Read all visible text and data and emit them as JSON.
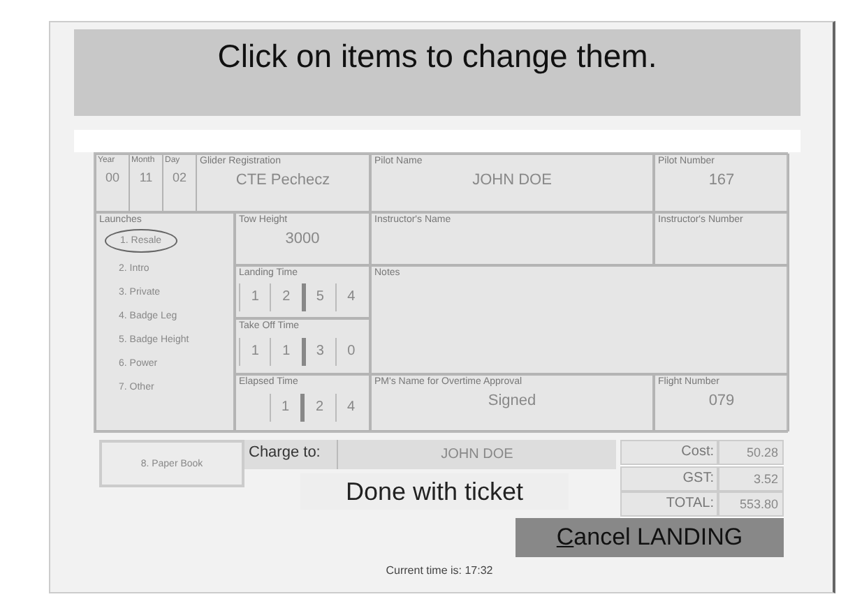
{
  "banner": "Click on items to change them.",
  "date": [
    {
      "label": "Year",
      "value": "00"
    },
    {
      "label": "Month",
      "value": "11"
    },
    {
      "label": "Day",
      "value": "02"
    }
  ],
  "glider": {
    "label": "Glider Registration",
    "value": "CTE  Pechecz"
  },
  "pilot_name": {
    "label": "Pilot Name",
    "value": "JOHN DOE"
  },
  "pilot_number": {
    "label": "Pilot Number",
    "value": "167"
  },
  "launch_type": {
    "label": "Launches",
    "options": [
      {
        "label": "1. Resale",
        "selected": true
      },
      {
        "label": "2. Intro",
        "selected": false
      },
      {
        "label": "3. Private",
        "selected": false
      },
      {
        "label": "4. Badge Leg",
        "selected": false
      },
      {
        "label": "5. Badge Height",
        "selected": false
      },
      {
        "label": "6. Power",
        "selected": false
      },
      {
        "label": "7. Other",
        "selected": false
      }
    ]
  },
  "tow_height": {
    "label": "Tow Height",
    "value": "3000"
  },
  "instructor_name": {
    "label": "Instructor's Name"
  },
  "instructor_number": {
    "label": "Instructor's Number"
  },
  "landing_time": {
    "label": "Landing Time",
    "digits": [
      "1",
      "2",
      "5",
      "4"
    ]
  },
  "takeoff_time": {
    "label": "Take Off Time",
    "digits": [
      "1",
      "1",
      "3",
      "0"
    ]
  },
  "elapsed_time": {
    "label": "Elapsed Time",
    "digits": [
      "1",
      "2",
      "4"
    ]
  },
  "notes": {
    "label": "Notes"
  },
  "approval": {
    "label": "PM's Name for Overtime Approval",
    "value": "Signed"
  },
  "flight_number": {
    "label": "Flight Number",
    "value": "079"
  },
  "paper_book_button": "8. Paper Book",
  "charge_to": {
    "label": "Charge to:",
    "value": "JOHN DOE"
  },
  "totals": [
    {
      "label": "Cost:",
      "value": "50.28"
    },
    {
      "label": "GST:",
      "value": "3.52"
    },
    {
      "label": "TOTAL:",
      "value": "553.80"
    }
  ],
  "done_button": "Done with ticket",
  "cancel_button": "Cancel LANDING",
  "status": "Current time is: 17:32"
}
